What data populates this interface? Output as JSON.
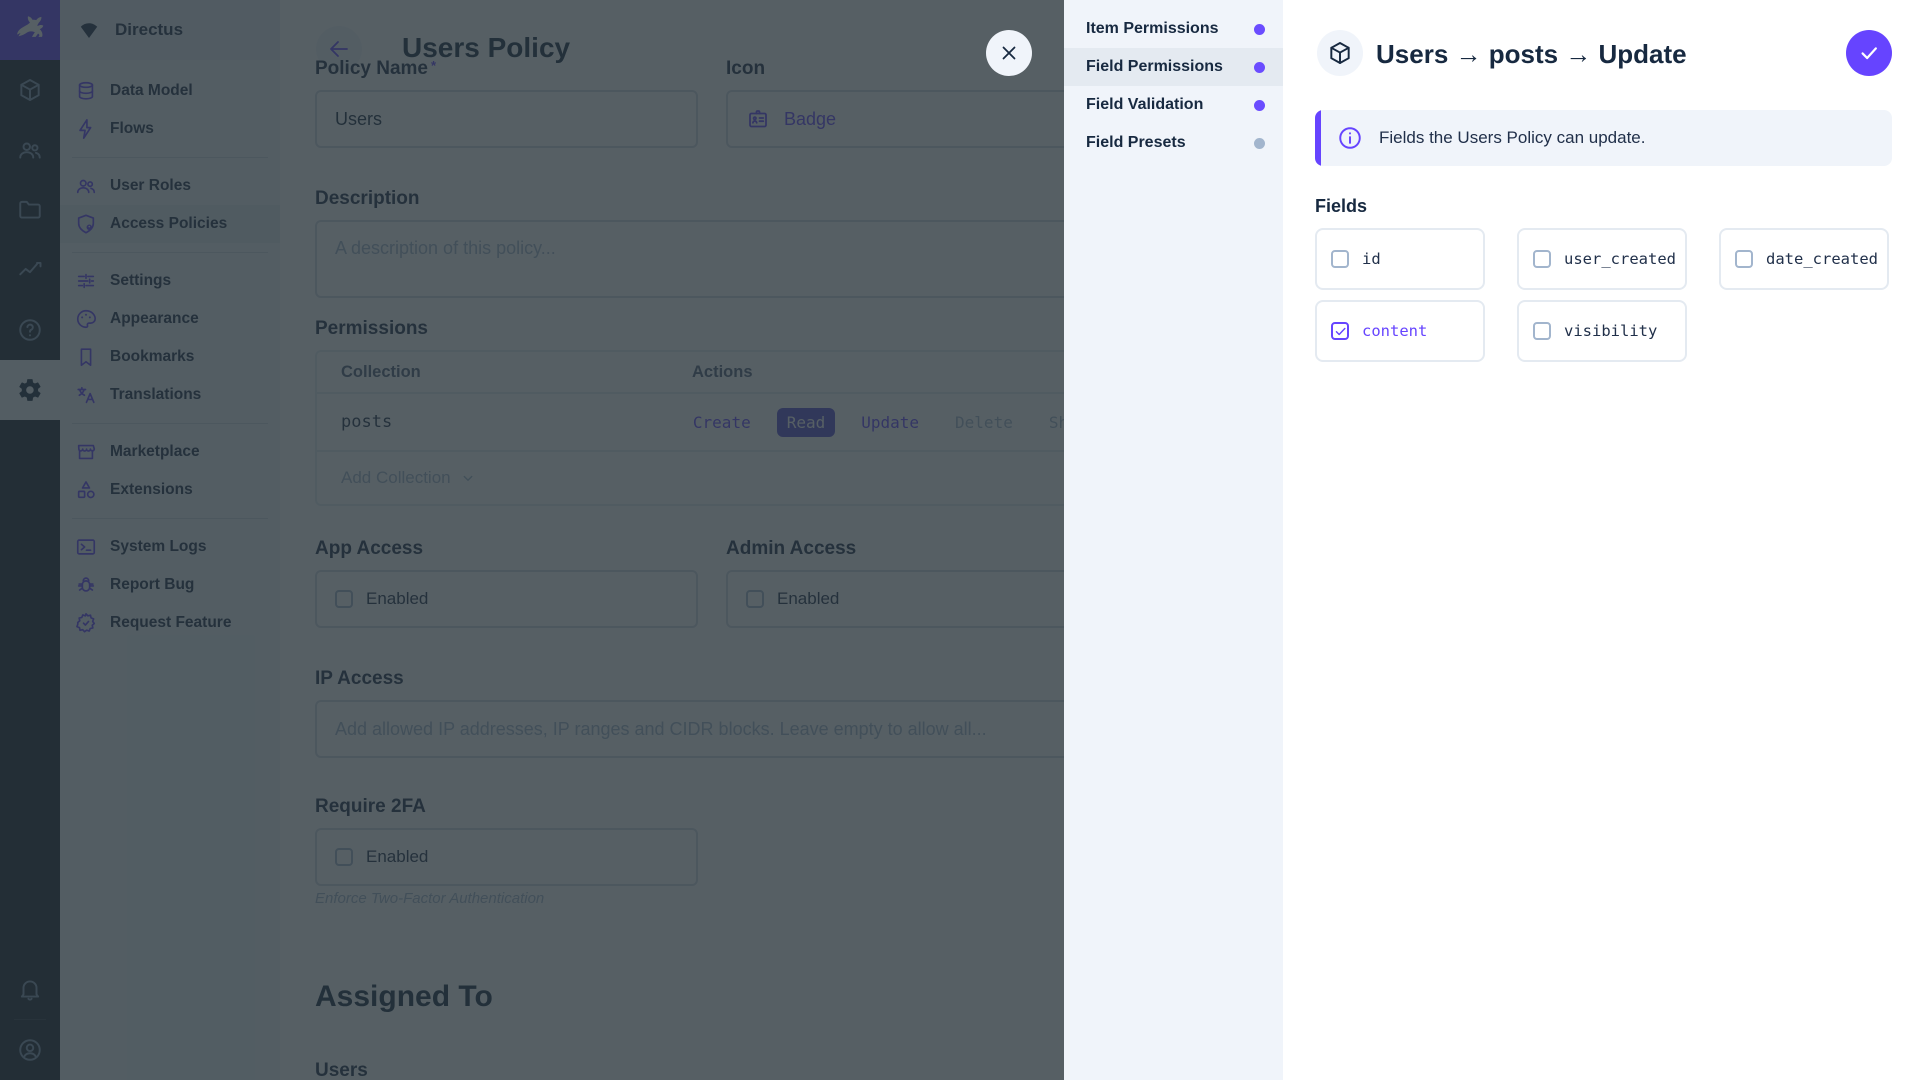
{
  "colors": {
    "brand": "#6644ff",
    "module_bar_bg": "#18222f",
    "nav_bg": "#f0f4fa",
    "overlay": "rgba(38,50,56,0.78)",
    "text_dark": "#172940",
    "muted": "#a2b5cd"
  },
  "nav": {
    "project_name": "Directus",
    "groups": [
      {
        "items": [
          {
            "label": "Data Model"
          },
          {
            "label": "Flows"
          }
        ]
      },
      {
        "items": [
          {
            "label": "User Roles"
          },
          {
            "label": "Access Policies",
            "active": true
          }
        ]
      },
      {
        "items": [
          {
            "label": "Settings"
          },
          {
            "label": "Appearance"
          },
          {
            "label": "Bookmarks"
          },
          {
            "label": "Translations"
          }
        ]
      },
      {
        "items": [
          {
            "label": "Marketplace"
          },
          {
            "label": "Extensions"
          }
        ]
      },
      {
        "items": [
          {
            "label": "System Logs"
          },
          {
            "label": "Report Bug"
          },
          {
            "label": "Request Feature"
          }
        ]
      }
    ]
  },
  "main": {
    "title": "Users Policy",
    "policy_name": {
      "label": "Policy Name",
      "required_mark": "*",
      "value": "Users"
    },
    "icon_field": {
      "label": "Icon",
      "value": "Badge"
    },
    "description": {
      "label": "Description",
      "placeholder": "A description of this policy..."
    },
    "permissions": {
      "label": "Permissions",
      "columns": {
        "collection": "Collection",
        "actions": "Actions"
      },
      "row": {
        "collection": "posts"
      },
      "actions": [
        {
          "label": "Create",
          "state": "enabled"
        },
        {
          "label": "Read",
          "state": "selected"
        },
        {
          "label": "Update",
          "state": "enabled"
        },
        {
          "label": "Delete",
          "state": "disabled"
        },
        {
          "label": "Share",
          "state": "disabled"
        }
      ],
      "add_label": "Add Collection"
    },
    "app_access": {
      "label": "App Access",
      "checkbox_label": "Enabled",
      "checked": false
    },
    "admin_access": {
      "label": "Admin Access",
      "checkbox_label": "Enabled",
      "checked": false
    },
    "ip_access": {
      "label": "IP Access",
      "placeholder": "Add allowed IP addresses, IP ranges and CIDR blocks. Leave empty to allow all..."
    },
    "require_2fa": {
      "label": "Require 2FA",
      "checkbox_label": "Enabled",
      "checked": false,
      "note": "Enforce Two-Factor Authentication"
    },
    "assigned_to": {
      "title": "Assigned To",
      "users_label": "Users"
    }
  },
  "drawer": {
    "nav": [
      {
        "label": "Item Permissions",
        "dot": "on",
        "active": false
      },
      {
        "label": "Field Permissions",
        "dot": "on",
        "active": true
      },
      {
        "label": "Field Validation",
        "dot": "on",
        "active": false
      },
      {
        "label": "Field Presets",
        "dot": "off",
        "active": false
      }
    ],
    "header": {
      "title": "Users → posts → Update"
    },
    "banner": {
      "text": "Fields the Users Policy can update."
    },
    "fields_label": "Fields",
    "fields": [
      {
        "label": "id",
        "checked": false
      },
      {
        "label": "user_created",
        "checked": false
      },
      {
        "label": "date_created",
        "checked": false
      },
      {
        "label": "content",
        "checked": true
      },
      {
        "label": "visibility",
        "checked": false
      }
    ]
  }
}
